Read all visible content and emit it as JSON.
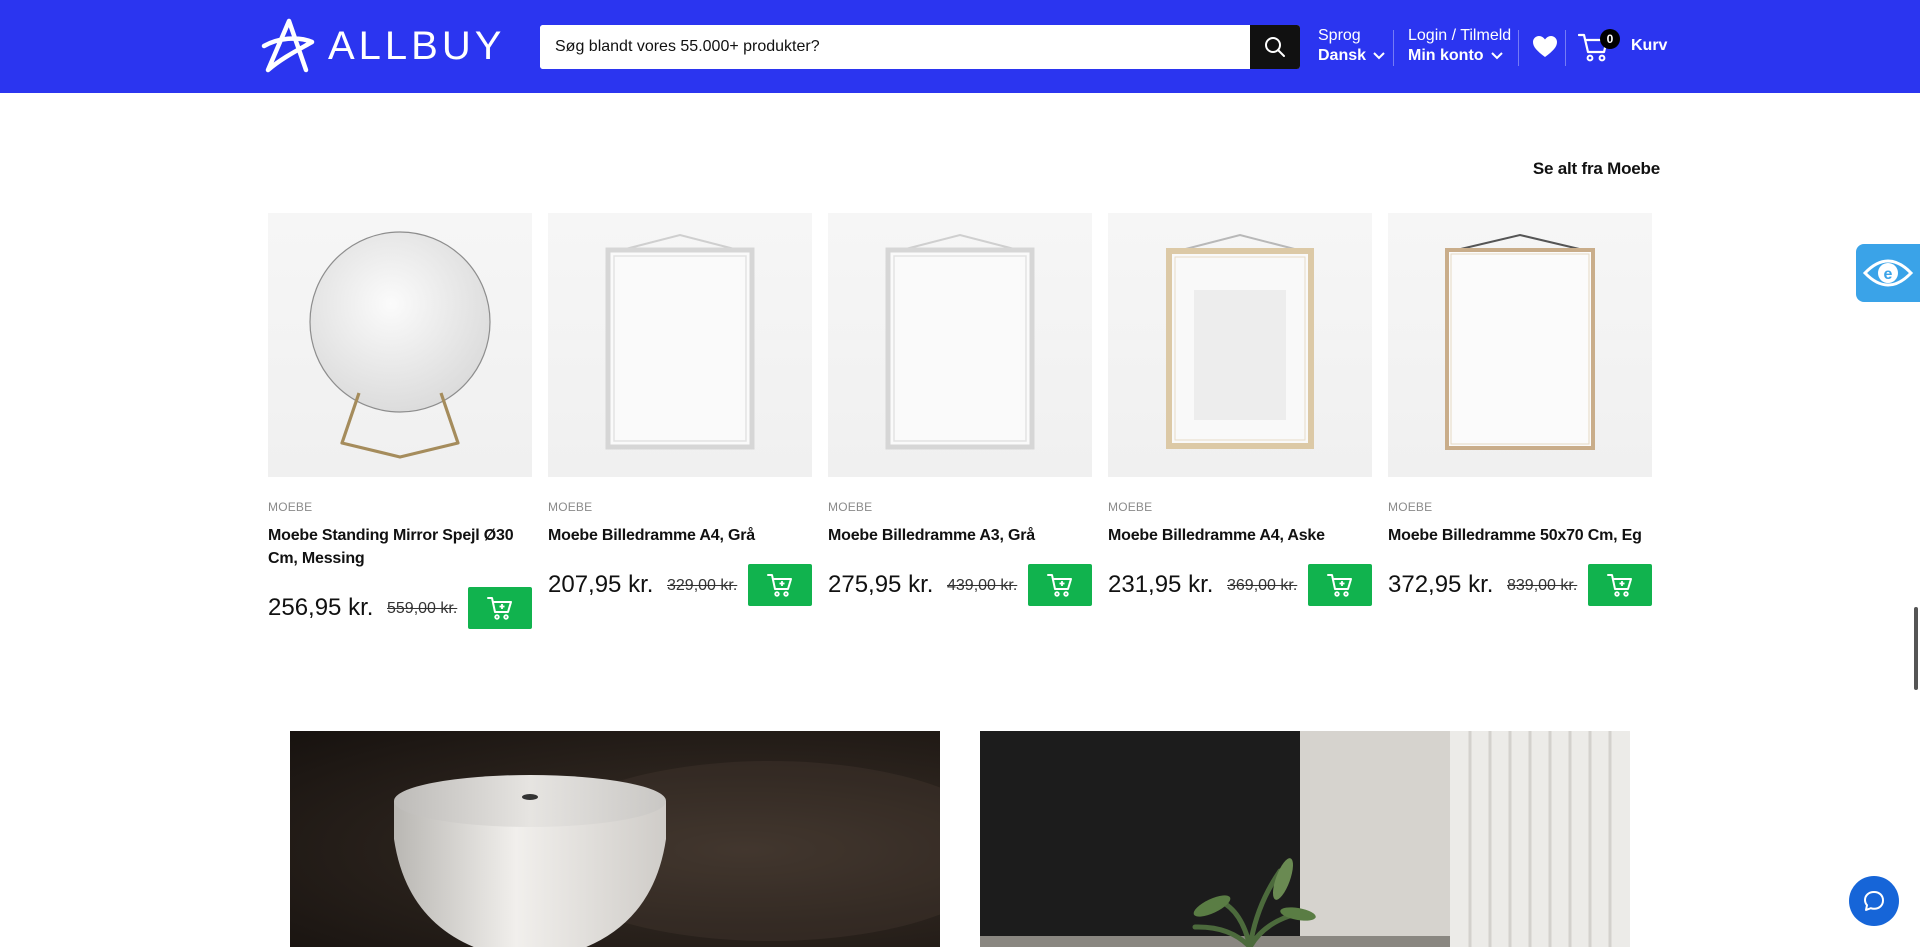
{
  "header": {
    "logo_text": "ALLBUY",
    "search_placeholder": "Søg blandt vores 55.000+ produkter?",
    "language_label": "Sprog",
    "language_value": "Dansk",
    "login_label": "Login / Tilmeld",
    "account_label": "Min konto",
    "cart_count": "0",
    "cart_label": "Kurv",
    "brand_color": "#2b35f0"
  },
  "section": {
    "see_all_label": "Se alt fra Moebe"
  },
  "products": [
    {
      "brand": "MOEBE",
      "name": "Moebe Standing Mirror Spejl Ø30 Cm, Messing",
      "price": "256,95 kr.",
      "old_price": "559,00 kr.",
      "image": "mirror"
    },
    {
      "brand": "MOEBE",
      "name": "Moebe Billedramme A4, Grå",
      "price": "207,95 kr.",
      "old_price": "329,00 kr.",
      "image": "frame-grey"
    },
    {
      "brand": "MOEBE",
      "name": "Moebe Billedramme A3, Grå",
      "price": "275,95 kr.",
      "old_price": "439,00 kr.",
      "image": "frame-grey"
    },
    {
      "brand": "MOEBE",
      "name": "Moebe Billedramme A4, Aske",
      "price": "231,95 kr.",
      "old_price": "369,00 kr.",
      "image": "frame-ash"
    },
    {
      "brand": "MOEBE",
      "name": "Moebe Billedramme 50x70 Cm, Eg",
      "price": "372,95 kr.",
      "old_price": "839,00 kr.",
      "image": "frame-oak"
    }
  ],
  "colors": {
    "add_to_cart": "#11b34e",
    "accessibility_widget": "#3aa3e8",
    "chat_button": "#1665d8"
  },
  "icons": [
    "search-icon",
    "chevron-down-icon",
    "heart-icon",
    "cart-icon",
    "add-to-cart-icon",
    "accessibility-eye-icon",
    "chat-icon"
  ]
}
